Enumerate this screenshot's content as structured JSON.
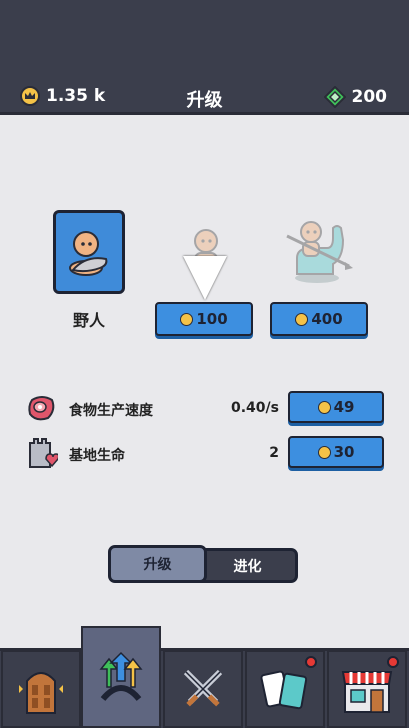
{
  "header": {
    "gold": "1.35 k",
    "title": "升级",
    "gems": "200"
  },
  "units": {
    "current": {
      "name": "野人"
    },
    "next1": {
      "price": "100"
    },
    "next2": {
      "price": "400"
    }
  },
  "stats": [
    {
      "label": "食物生产速度",
      "value": "0.40/s",
      "price": "49",
      "icon": "meat-icon"
    },
    {
      "label": "基地生命",
      "value": "2",
      "price": "30",
      "icon": "castle-heart-icon"
    }
  ],
  "segments": {
    "upgrade": "升级",
    "evolve": "进化"
  },
  "tabs": [
    {
      "icon": "door-icon",
      "badge": false
    },
    {
      "icon": "upgrade-arrows-icon",
      "badge": false,
      "active": true
    },
    {
      "icon": "crossed-swords-icon",
      "badge": false
    },
    {
      "icon": "cards-icon",
      "badge": true
    },
    {
      "icon": "shop-icon",
      "badge": true
    }
  ],
  "colors": {
    "topbar": "#3b3e4c",
    "button": "#3d8fe0",
    "coin": "#f4c247",
    "gem": "#3fbf5a",
    "badge": "#e53935"
  }
}
